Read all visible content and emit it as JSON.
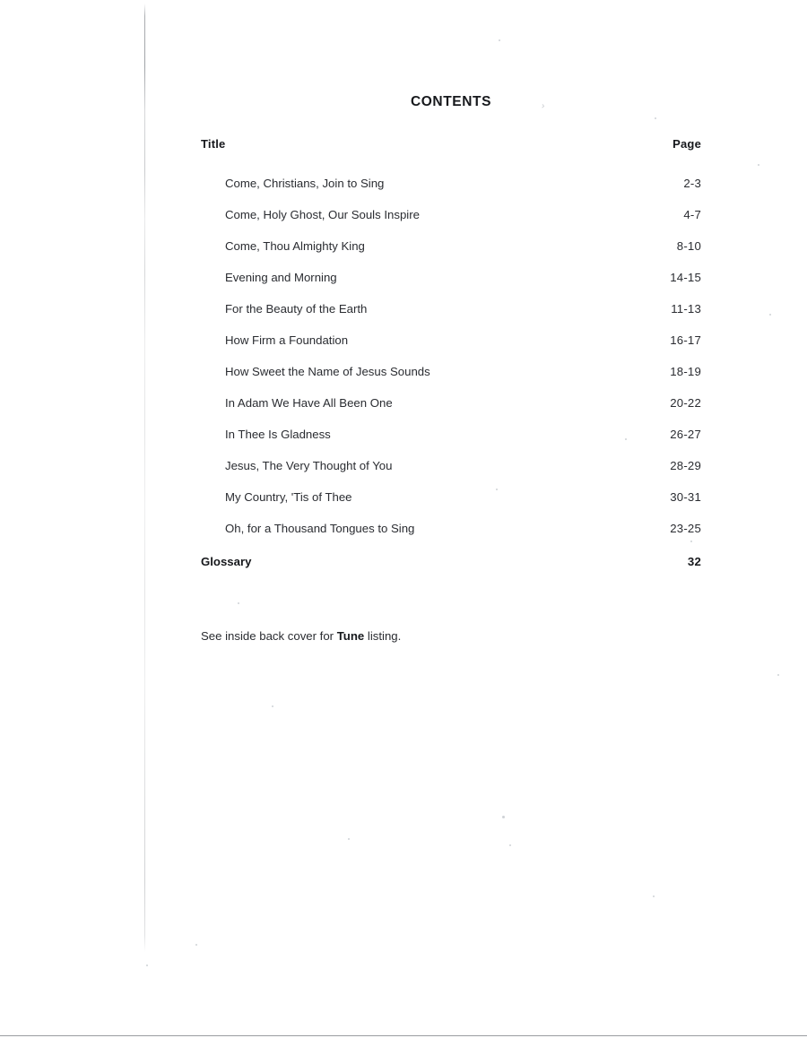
{
  "document": {
    "heading": "CONTENTS",
    "stray_mark": "›",
    "columns": {
      "title": "Title",
      "page": "Page"
    },
    "entries": [
      {
        "title": "Come, Christians, Join to Sing",
        "pages": "2-3"
      },
      {
        "title": "Come, Holy Ghost, Our Souls Inspire",
        "pages": "4-7"
      },
      {
        "title": "Come, Thou Almighty King",
        "pages": "8-10"
      },
      {
        "title": "Evening and Morning",
        "pages": "14-15"
      },
      {
        "title": "For the Beauty of the Earth",
        "pages": "11-13"
      },
      {
        "title": "How Firm a Foundation",
        "pages": "16-17"
      },
      {
        "title": "How Sweet the Name of Jesus Sounds",
        "pages": "18-19"
      },
      {
        "title": "In Adam We Have All Been One",
        "pages": "20-22"
      },
      {
        "title": "In Thee Is Gladness",
        "pages": "26-27"
      },
      {
        "title": "Jesus, The Very Thought of You",
        "pages": "28-29"
      },
      {
        "title": "My Country, 'Tis of Thee",
        "pages": "30-31"
      },
      {
        "title": "Oh, for a Thousand Tongues to Sing",
        "pages": "23-25"
      }
    ],
    "section": {
      "title": "Glossary",
      "pages": "32"
    },
    "footnote": {
      "before": "See inside back cover for ",
      "emphasis": "Tune",
      "after": " listing."
    }
  }
}
